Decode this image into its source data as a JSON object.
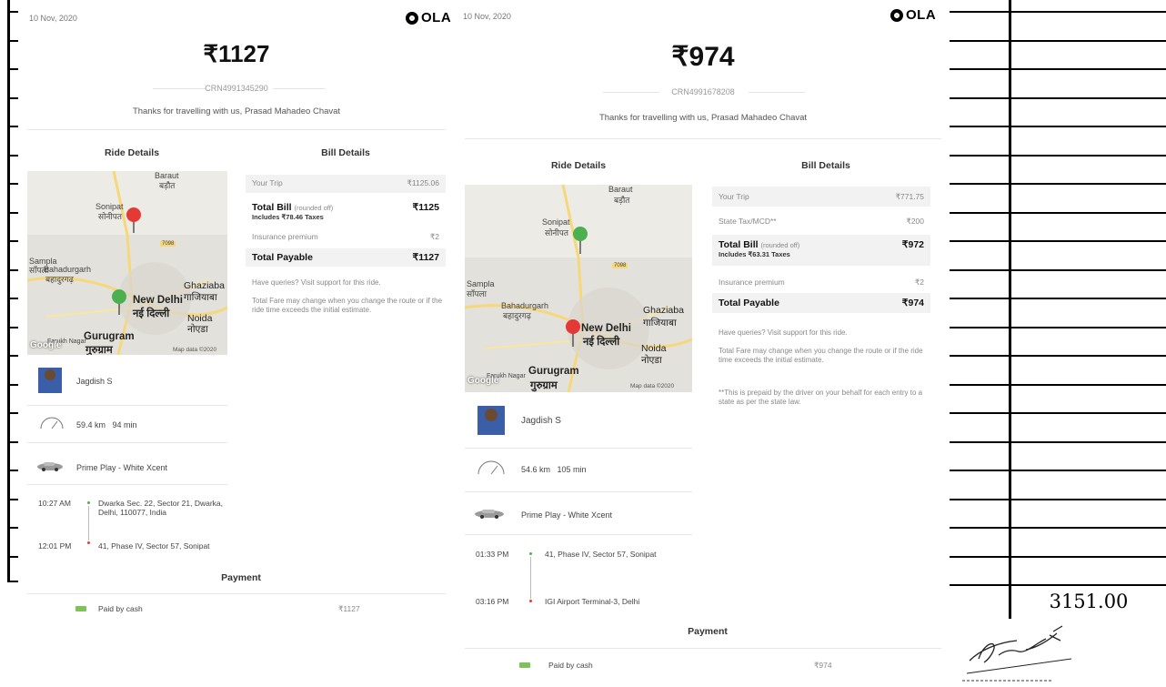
{
  "brand": "OLA",
  "ledger_total": "3151.00",
  "receipts": [
    {
      "date": "10 Nov, 2020",
      "amount": "₹1127",
      "crn": "CRN4991345290",
      "thanks": "Thanks for travelling with us, Prasad Mahadeo Chavat",
      "ride_details_title": "Ride Details",
      "bill_details_title": "Bill Details",
      "bill": {
        "your_trip_label": "Your Trip",
        "your_trip_value": "₹1125.06",
        "total_bill_label": "Total Bill",
        "rounded_note": "(rounded off)",
        "taxes_note": "Includes ₹78.46 Taxes",
        "total_bill_value": "₹1125",
        "insurance_label": "Insurance premium",
        "insurance_value": "₹2",
        "payable_label": "Total Payable",
        "payable_value": "₹1127"
      },
      "queries": "Have queries? Visit support for this ride.",
      "fare_note": "Total Fare may change when you change the route or if the ride time exceeds the initial estimate.",
      "map": {
        "labels": [
          "Baraut",
          "बड़ौत",
          "Sonipat",
          "सोनीपत",
          "Sampla",
          "साँपला",
          "Bahadurgarh",
          "बहादुरगढ़",
          "Ghaziaba",
          "गाजियाबा",
          "New Delhi",
          "नई दिल्ली",
          "Noida",
          "नोएडा",
          "Gurugram",
          "गुरुग्राम",
          "Farukh Nagar",
          "7098"
        ],
        "credit": "Map data ©2020",
        "google": "Google"
      },
      "driver": "Jagdish S",
      "distance": "59.4 km",
      "duration": "94 min",
      "car": "Prime Play - White Xcent",
      "pickup_time": "10:27 AM",
      "pickup_addr": "Dwarka Sec. 22, Sector 21, Dwarka, Delhi, 110077, India",
      "drop_time": "12:01 PM",
      "drop_addr": "41, Phase IV, Sector 57, Sonipat",
      "payment_title": "Payment",
      "paid_by": "Paid by cash",
      "paid_amount": "₹1127"
    },
    {
      "date": "10 Nov, 2020",
      "amount": "₹974",
      "crn": "CRN4991678208",
      "thanks": "Thanks for travelling with us, Prasad Mahadeo Chavat",
      "ride_details_title": "Ride Details",
      "bill_details_title": "Bill Details",
      "bill": {
        "your_trip_label": "Your Trip",
        "your_trip_value": "₹771.75",
        "state_tax_label": "State Tax/MCD**",
        "state_tax_value": "₹200",
        "total_bill_label": "Total Bill",
        "rounded_note": "(rounded off)",
        "taxes_note": "Includes ₹63.31 Taxes",
        "total_bill_value": "₹972",
        "insurance_label": "Insurance premium",
        "insurance_value": "₹2",
        "payable_label": "Total Payable",
        "payable_value": "₹974"
      },
      "queries": "Have queries? Visit support for this ride.",
      "fare_note": "Total Fare may change when you change the route or if the ride time exceeds the initial estimate.",
      "prepaid_note": "**This is prepaid by the driver on your behalf for each entry to a state as per the state law.",
      "map": {
        "labels": [
          "Baraut",
          "बड़ौत",
          "Sonipat",
          "सोनीपत",
          "Sampla",
          "साँपला",
          "Bahadurgarh",
          "बहादुरगढ़",
          "Ghaziaba",
          "गाजियाबा",
          "New Delhi",
          "नई दिल्ली",
          "Noida",
          "नोएडा",
          "Gurugram",
          "गुरुग्राम",
          "Farukh Nagar",
          "7098"
        ],
        "credit": "Map data ©2020",
        "google": "Google"
      },
      "driver": "Jagdish S",
      "distance": "54.6 km",
      "duration": "105 min",
      "car": "Prime Play - White Xcent",
      "pickup_time": "01:33 PM",
      "pickup_addr": "41, Phase IV, Sector 57, Sonipat",
      "drop_time": "03:16 PM",
      "drop_addr": "IGI Airport Terminal-3, Delhi",
      "payment_title": "Payment",
      "paid_by": "Paid by cash",
      "paid_amount": "₹974"
    }
  ]
}
